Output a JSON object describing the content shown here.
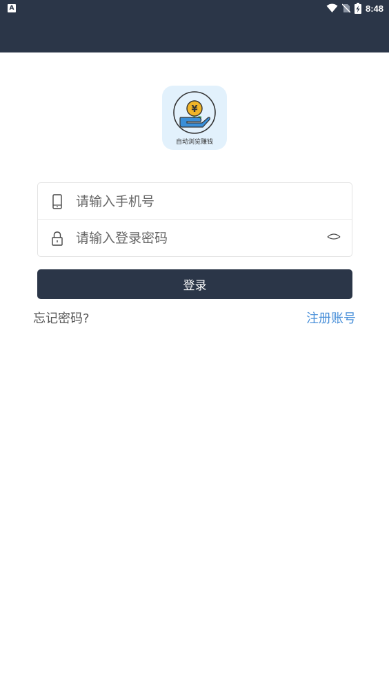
{
  "status_bar": {
    "time": "8:48",
    "notification_icon": "a-notification-icon",
    "wifi_icon": "wifi-icon",
    "sim_icon": "no-sim-icon",
    "battery_icon": "battery-charging-icon"
  },
  "logo": {
    "caption": "自动浏览赚钱",
    "coin_symbol": "¥"
  },
  "login_form": {
    "phone_placeholder": "请输入手机号",
    "password_placeholder": "请输入登录密码"
  },
  "actions": {
    "login_label": "登录",
    "forgot_label": "忘记密码?",
    "register_label": "注册账号"
  },
  "colors": {
    "header_bg": "#2b3648",
    "logo_bg": "#e2f1fc",
    "link": "#4a90d9",
    "hand": "#3a8fd8",
    "coin": "#f0b428"
  }
}
